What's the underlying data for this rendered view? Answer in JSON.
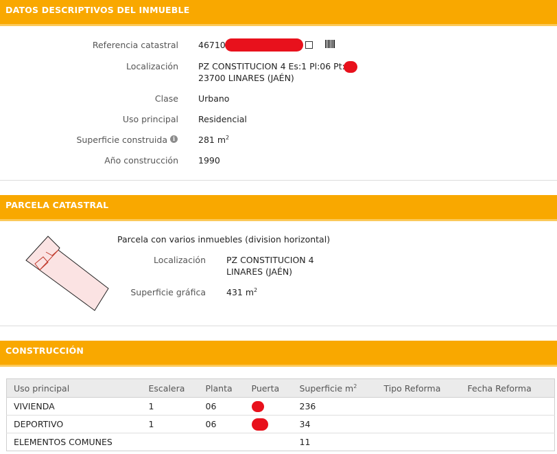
{
  "sections": {
    "datos": "DATOS DESCRIPTIVOS DEL INMUEBLE",
    "parcela": "PARCELA CATASTRAL",
    "construccion": "CONSTRUCCIÓN"
  },
  "inmueble": {
    "referencia_label": "Referencia catastral",
    "referencia_value": "46710",
    "localizacion_label": "Localización",
    "localizacion_line1": "PZ CONSTITUCION 4 Es:1 Pl:06 Pt:",
    "localizacion_line2": "23700 LINARES (JAÉN)",
    "clase_label": "Clase",
    "clase_value": "Urbano",
    "uso_label": "Uso principal",
    "uso_value": "Residencial",
    "superficie_label": "Superficie construida",
    "superficie_value": "281 m",
    "superficie_unit_sup": "2",
    "anio_label": "Año construcción",
    "anio_value": "1990"
  },
  "parcela": {
    "descripcion": "Parcela con varios inmuebles (division horizontal)",
    "localizacion_label": "Localización",
    "localizacion_line1": "PZ CONSTITUCION 4",
    "localizacion_line2": "LINARES (JAÉN)",
    "superficie_label": "Superficie gráfica",
    "superficie_value": "431 m",
    "superficie_unit_sup": "2"
  },
  "construccion": {
    "headers": [
      "Uso principal",
      "Escalera",
      "Planta",
      "Puerta",
      "Superficie m",
      "Tipo Reforma",
      "Fecha Reforma"
    ],
    "superficie_header_sup": "2",
    "rows": [
      {
        "uso": "VIVIENDA",
        "escalera": "1",
        "planta": "06",
        "superficie": "236"
      },
      {
        "uso": "DEPORTIVO",
        "escalera": "1",
        "planta": "06",
        "superficie": "34"
      },
      {
        "uso": "ELEMENTOS COMUNES",
        "escalera": "",
        "planta": "",
        "superficie": "11"
      }
    ]
  },
  "colors": {
    "header_band": "#f9a800",
    "redaction": "#e8111c",
    "parcel_fill": "#fbe3e3",
    "parcel_stroke": "#c0392b"
  }
}
